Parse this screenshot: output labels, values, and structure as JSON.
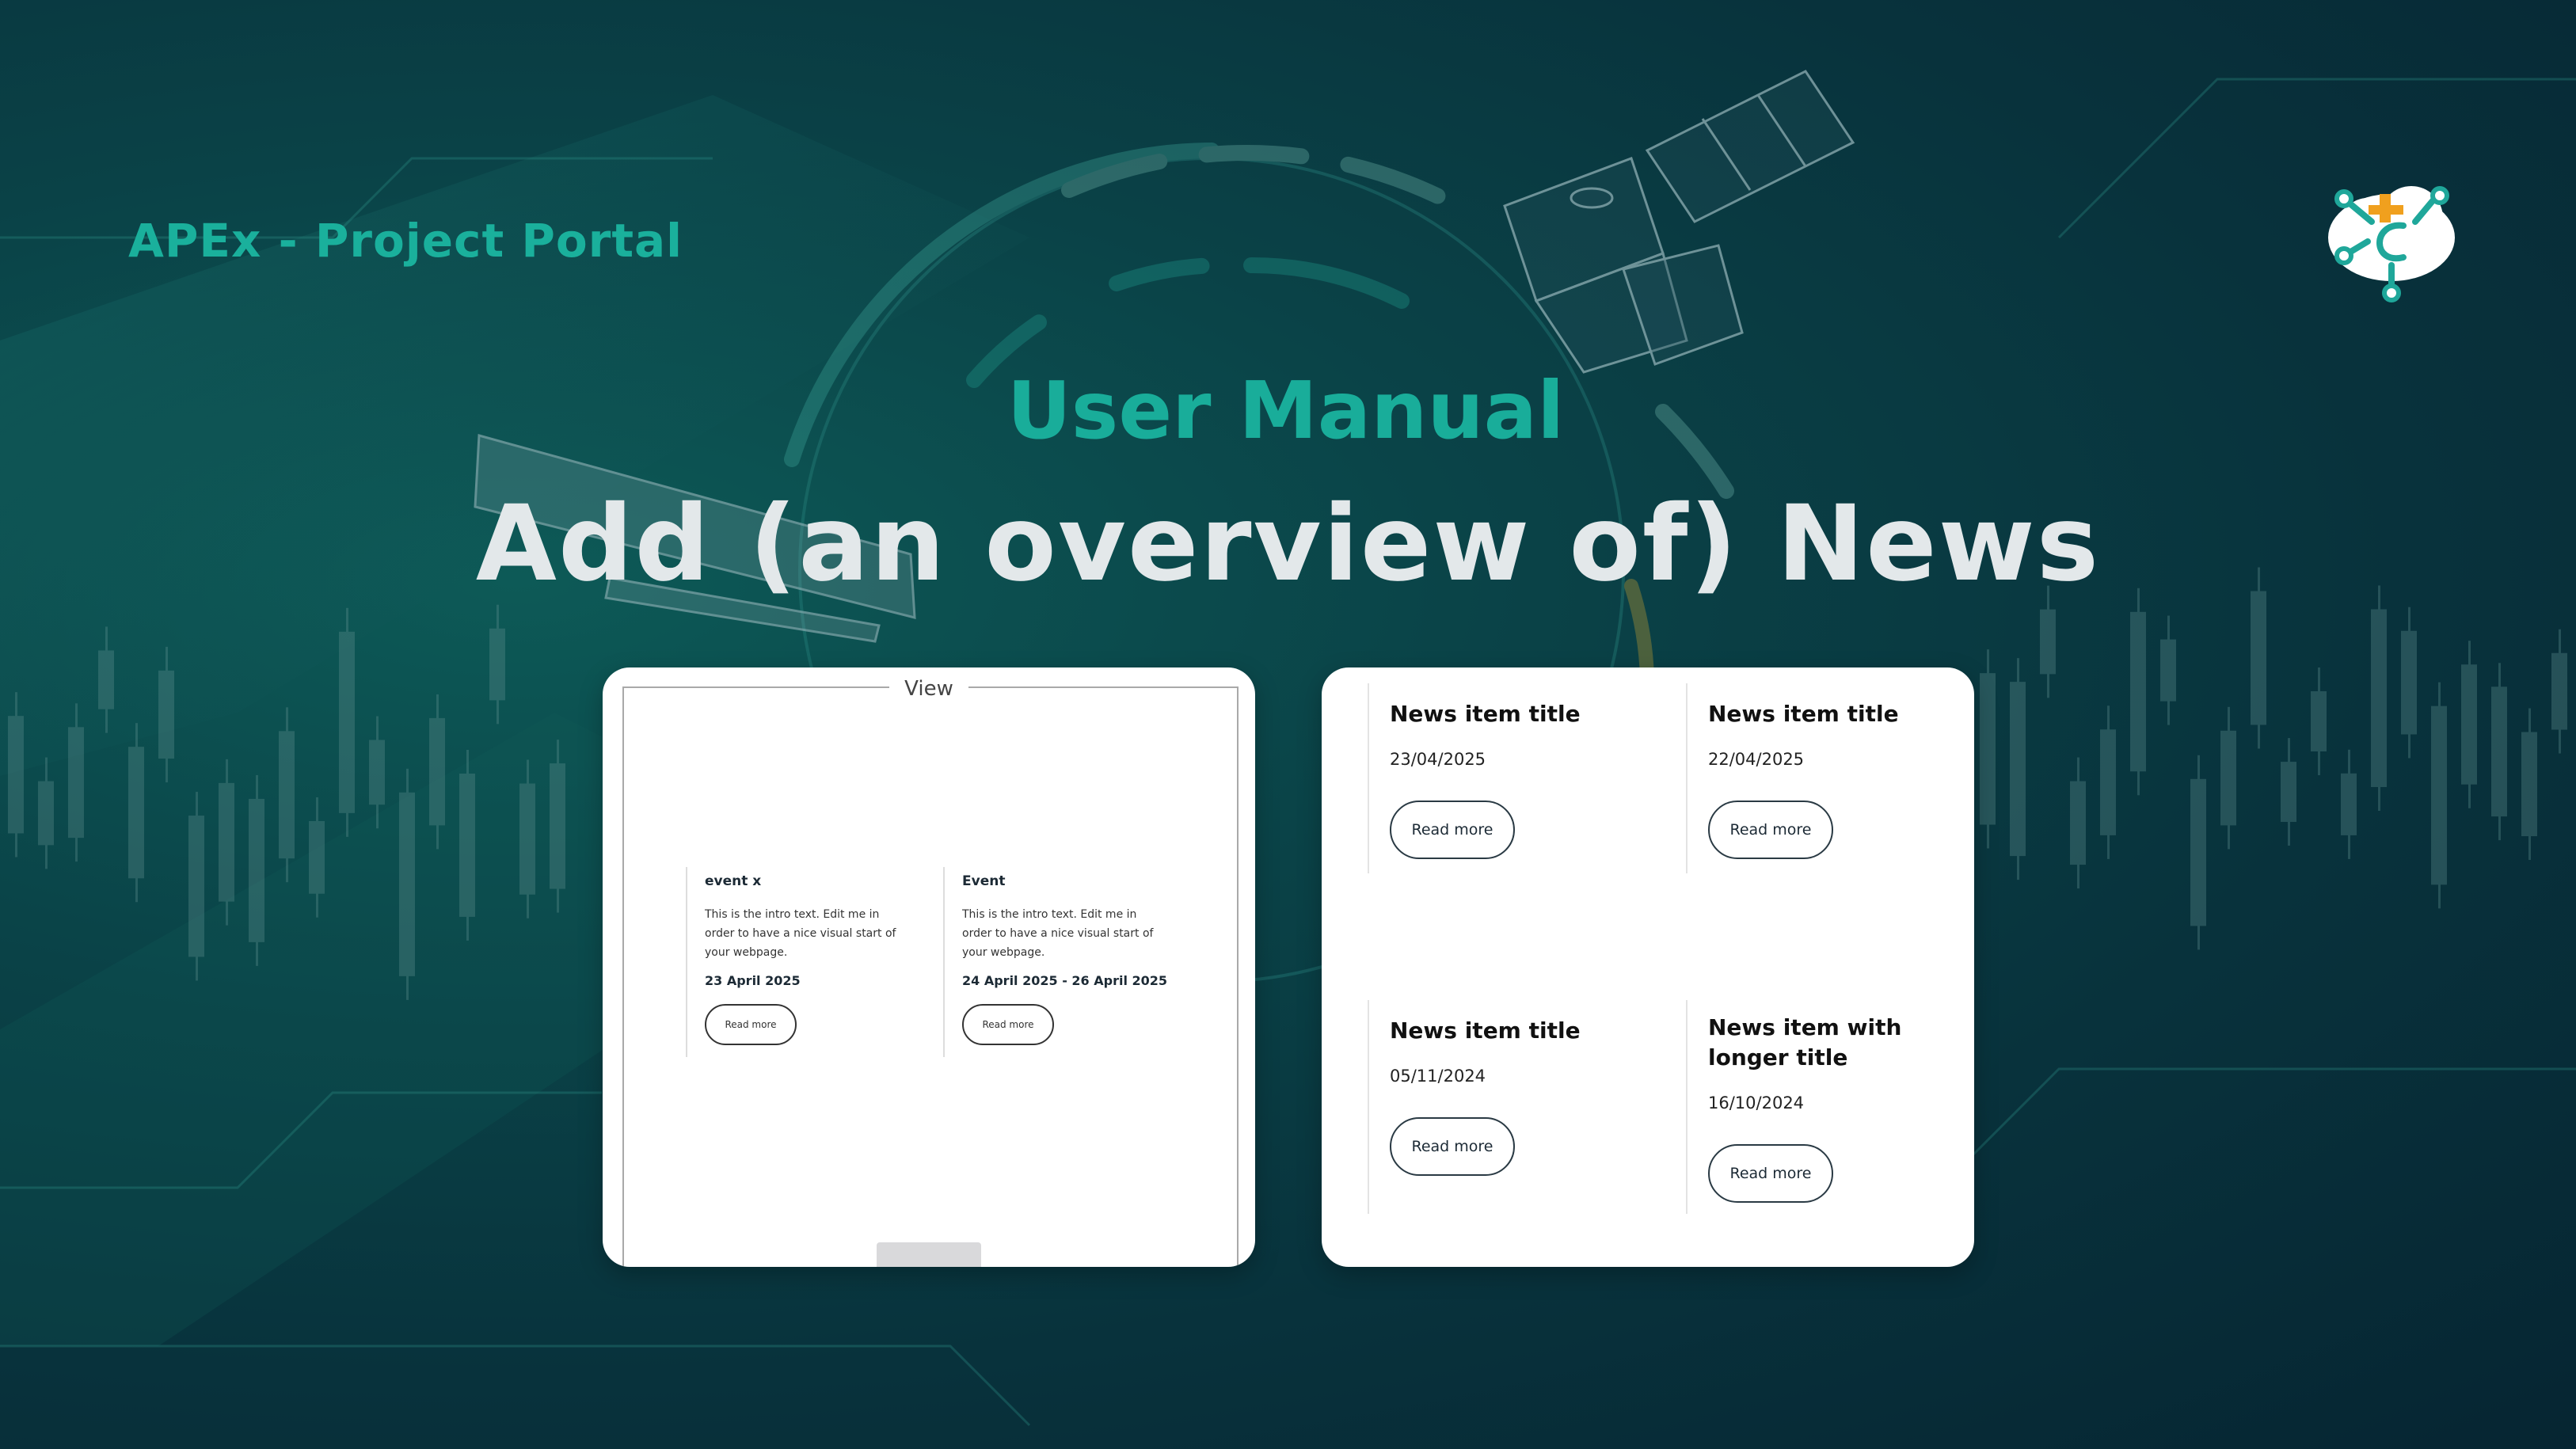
{
  "header": {
    "portal_title": "APEx - Project Portal",
    "logo_icon": "apex-cloud-logo-icon"
  },
  "hero": {
    "subtitle": "User Manual",
    "title": "Add (an overview of) News"
  },
  "colors": {
    "accent": "#19ad9a",
    "title": "#e3e8ea",
    "background": "#08323c",
    "logo_orange": "#f0a01e"
  },
  "left_card": {
    "view_label": "View",
    "events": [
      {
        "title": "event x",
        "text": "This is the intro text. Edit me in order to have a nice visual start of your webpage.",
        "date": "23 April 2025",
        "button": "Read more"
      },
      {
        "title": "Event",
        "text": "This is the intro text. Edit me in order to have a nice visual start of your webpage.",
        "date": "24 April 2025 - 26 April 2025",
        "button": "Read more"
      }
    ]
  },
  "right_card": {
    "news": [
      {
        "title": "News item title",
        "date": "23/04/2025",
        "button": "Read more"
      },
      {
        "title": "News item title",
        "date": "22/04/2025",
        "button": "Read more"
      },
      {
        "title": "News item title",
        "date": "05/11/2024",
        "button": "Read more"
      },
      {
        "title": "News item with longer title",
        "date": "16/10/2024",
        "button": "Read more"
      }
    ]
  }
}
